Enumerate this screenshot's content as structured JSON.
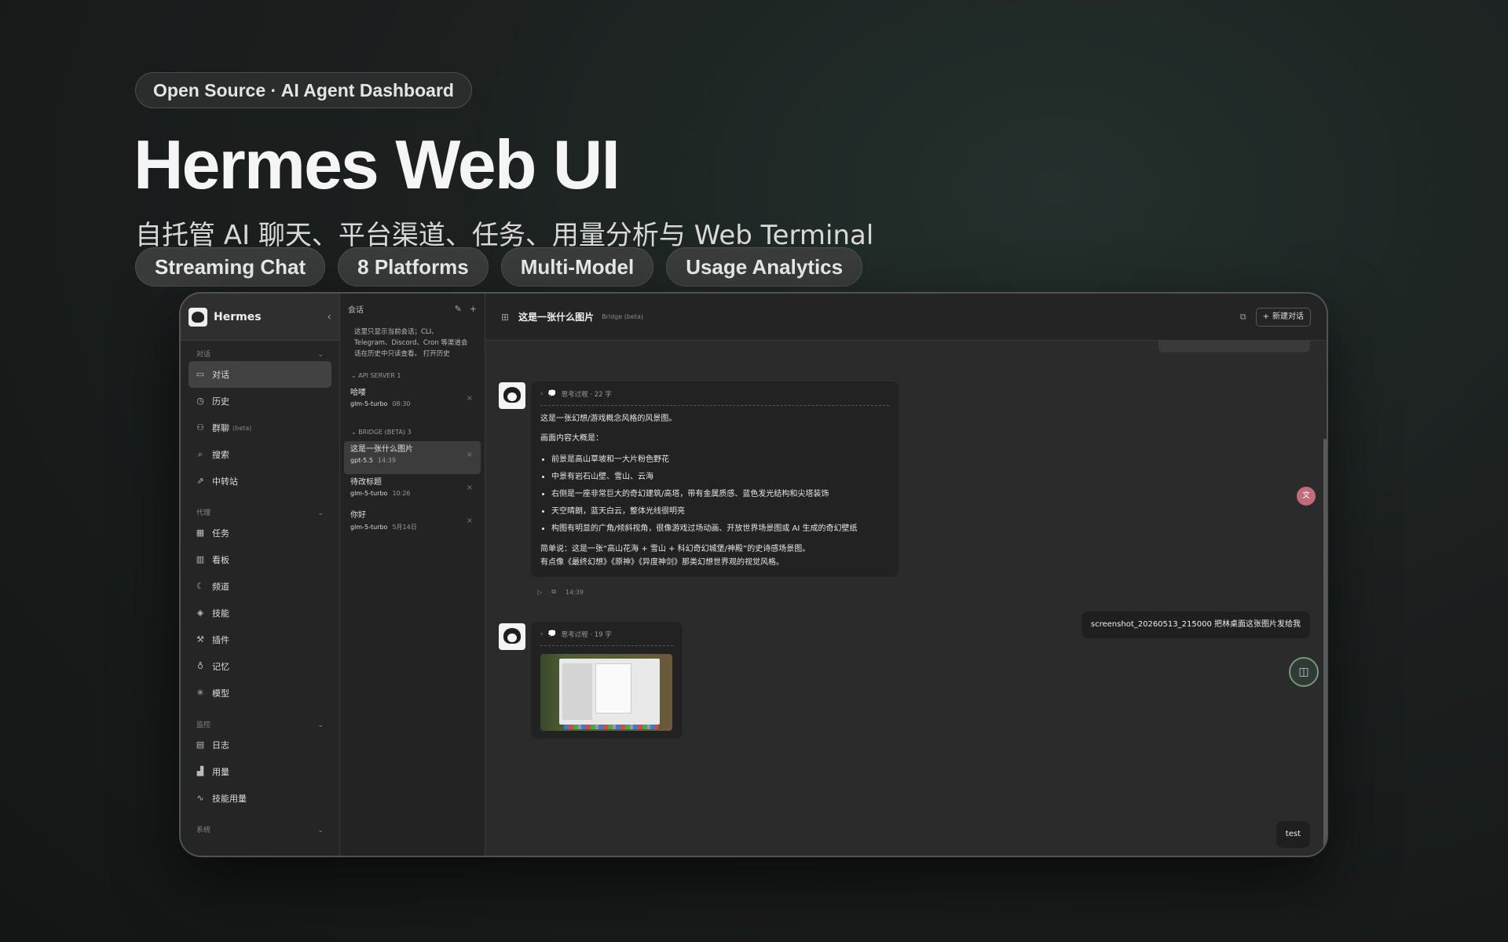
{
  "hero": {
    "badge": "Open Source · AI Agent Dashboard",
    "title": "Hermes Web UI",
    "subtitle": "自托管 AI 聊天、平台渠道、任务、用量分析与 Web Terminal",
    "features": [
      "Streaming Chat",
      "8 Platforms",
      "Multi-Model",
      "Usage Analytics"
    ]
  },
  "sidebar": {
    "app_name": "Hermes",
    "collapse_icon": "chevron-left-icon",
    "sections": [
      {
        "title": "对话",
        "items": [
          {
            "label": "对话",
            "icon": "chat-icon",
            "active": true
          },
          {
            "label": "历史",
            "icon": "clock-icon"
          },
          {
            "label": "群聊",
            "badge": "(beta)",
            "icon": "users-icon"
          },
          {
            "label": "搜索",
            "icon": "search-icon"
          },
          {
            "label": "中转站",
            "icon": "external-link-icon"
          }
        ]
      },
      {
        "title": "代理",
        "items": [
          {
            "label": "任务",
            "icon": "calendar-icon"
          },
          {
            "label": "看板",
            "icon": "board-icon"
          },
          {
            "label": "频道",
            "icon": "moon-icon"
          },
          {
            "label": "技能",
            "icon": "layers-icon"
          },
          {
            "label": "插件",
            "icon": "wrench-icon"
          },
          {
            "label": "记忆",
            "icon": "bulb-icon"
          },
          {
            "label": "模型",
            "icon": "sparkle-icon"
          }
        ]
      },
      {
        "title": "监控",
        "items": [
          {
            "label": "日志",
            "icon": "file-icon"
          },
          {
            "label": "用量",
            "icon": "bar-chart-icon"
          },
          {
            "label": "技能用量",
            "icon": "activity-icon"
          }
        ]
      },
      {
        "title": "系统",
        "items": []
      }
    ]
  },
  "sessions": {
    "header": "会话",
    "note": "这里只显示当前会话；CLI、Telegram、Discord、Cron 等渠道会话在历史中只读查看。 打开历史",
    "groups": [
      {
        "title": "API SERVER 1",
        "items": [
          {
            "title": "哈喽",
            "model": "glm-5-turbo",
            "time": "08:30"
          }
        ]
      },
      {
        "title": "BRIDGE (BETA) 3",
        "items": [
          {
            "title": "这是一张什么图片",
            "model": "gpt-5.5",
            "time": "14:39",
            "active": true
          },
          {
            "title": "待改标题",
            "model": "glm-5-turbo",
            "time": "10:26"
          },
          {
            "title": "你好",
            "model": "glm-5-turbo",
            "time": "5月14日"
          }
        ]
      }
    ]
  },
  "chat": {
    "title": "这是一张什么图片",
    "tag": "Bridge (beta)",
    "new_chat": "新建对话",
    "msg1": {
      "think": "思考过程 · 22 字",
      "intro": "这是一张幻想/游戏概念风格的风景图。",
      "overview": "画面内容大概是：",
      "bullets": [
        "前景是高山草坡和一大片粉色野花",
        "中景有岩石山壁、雪山、云海",
        "右侧是一座非常巨大的奇幻建筑/高塔，带有金属质感、蓝色发光结构和尖塔装饰",
        "天空晴朗，蓝天白云，整体光线很明亮",
        "构图有明显的广角/倾斜视角，很像游戏过场动画、开放世界场景图或 AI 生成的奇幻壁纸"
      ],
      "summary1": "简单说：这是一张“高山花海 + 雪山 + 科幻奇幻城堡/神殿”的史诗感场景图。",
      "summary2": "有点像《最终幻想》《原神》《异度神剑》那类幻想世界观的视觉风格。",
      "time": "14:39"
    },
    "user1": "screenshot_20260513_215000 把林桌面这张图片发给我",
    "msg2": {
      "think": "思考过程 · 19 字"
    },
    "user2": "test"
  }
}
